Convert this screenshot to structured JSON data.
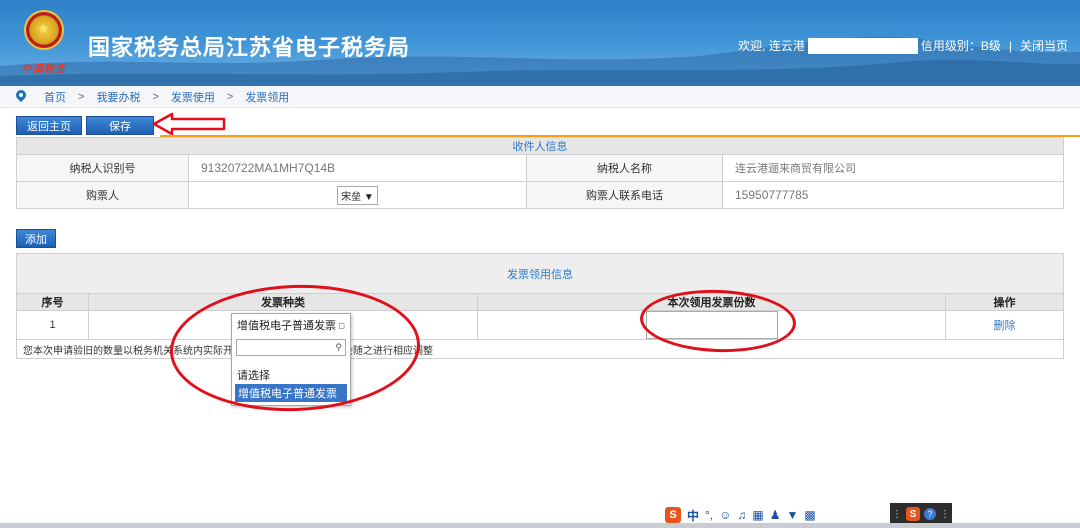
{
  "header": {
    "title": "国家税务总局江苏省电子税务局",
    "slogan": "中国税务",
    "welcome": "欢迎, 连云港",
    "credit_level": "信用级别：B级",
    "close_page": "关闭当页"
  },
  "breadcrumb": [
    "首页",
    "我要办税",
    "发票使用",
    "发票领用"
  ],
  "breadcrumb_sep": ">",
  "buttons": {
    "home": "返回主页",
    "save": "保存",
    "add": "添加"
  },
  "recipient": {
    "section_title": "收件人信息",
    "taxpayer_id_label": "纳税人识别号",
    "taxpayer_id": "91320722MA1MH7Q14B",
    "taxpayer_name_label": "纳税人名称",
    "taxpayer_name": "连云港逦来商贸有限公司",
    "buyer_label": "购票人",
    "buyer": "宋垒 ▼",
    "phone_label": "购票人联系电话",
    "phone": "15950777785"
  },
  "invoice": {
    "section_title": "发票领用信息",
    "col_seq": "序号",
    "col_type": "发票种类",
    "col_count": "本次领用发票份数",
    "col_action": "操作",
    "row_seq": "1",
    "row_action": "删除",
    "note": "您本次申请验旧的数量以税务机关系统内实际开具的数量为准，领用数量会随之进行相应调整"
  },
  "dropdown": {
    "current": "增值税电子普通发票",
    "options": [
      "请选择",
      "增值税电子普通发票"
    ],
    "selected": "增值税电子普通发票"
  },
  "ime": {
    "lang": "中",
    "punct": "°,"
  }
}
